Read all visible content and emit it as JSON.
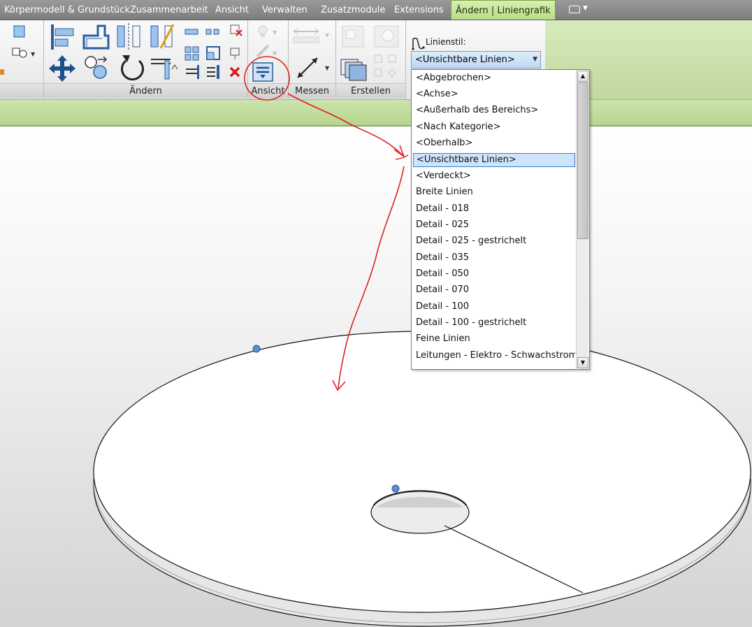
{
  "tabs": [
    {
      "label": "Körpermodell & Grundstück",
      "active": false
    },
    {
      "label": "Zusammenarbeit",
      "active": false
    },
    {
      "label": "Ansicht",
      "active": false
    },
    {
      "label": "Verwalten",
      "active": false
    },
    {
      "label": "Zusatzmodule",
      "active": false
    },
    {
      "label": "Extensions",
      "active": false
    },
    {
      "label": "Ändern | Liniengrafik",
      "active": true
    }
  ],
  "ribbon": {
    "panels": [
      "Ändern",
      "Ansicht",
      "Messen",
      "Erstellen"
    ],
    "line_style_label": "Linienstil:",
    "line_style_value": "<Unsichtbare Linien>"
  },
  "dropdown": {
    "options": [
      "<Abgebrochen>",
      "<Achse>",
      "<Außerhalb des Bereichs>",
      "<Nach Kategorie>",
      "<Oberhalb>",
      "<Unsichtbare Linien>",
      "<Verdeckt>",
      "Breite Linien",
      "Detail - 018",
      "Detail - 025",
      "Detail - 025 - gestrichelt",
      "Detail - 035",
      "Detail - 050",
      "Detail - 070",
      "Detail - 100",
      "Detail - 100 - gestrichelt",
      "Feine Linien",
      "Leitungen - Elektro - Schwachstrom"
    ],
    "selected_index": 5
  },
  "colors": {
    "active_tab": "#c6e69a",
    "selection": "#cde4fb",
    "selection_border": "#3b7bd0",
    "annotation": "#e02020",
    "grip": "#5b8ed8"
  },
  "icons": [
    "move-icon",
    "rotate-icon",
    "mirror-icon",
    "trim-icon",
    "copy-icon",
    "delete-icon",
    "show-hidden-lines-icon",
    "dimension-icon",
    "bulb-icon",
    "paint-icon",
    "create-parts-icon",
    "create-similar-icon",
    "line-style-icon"
  ]
}
